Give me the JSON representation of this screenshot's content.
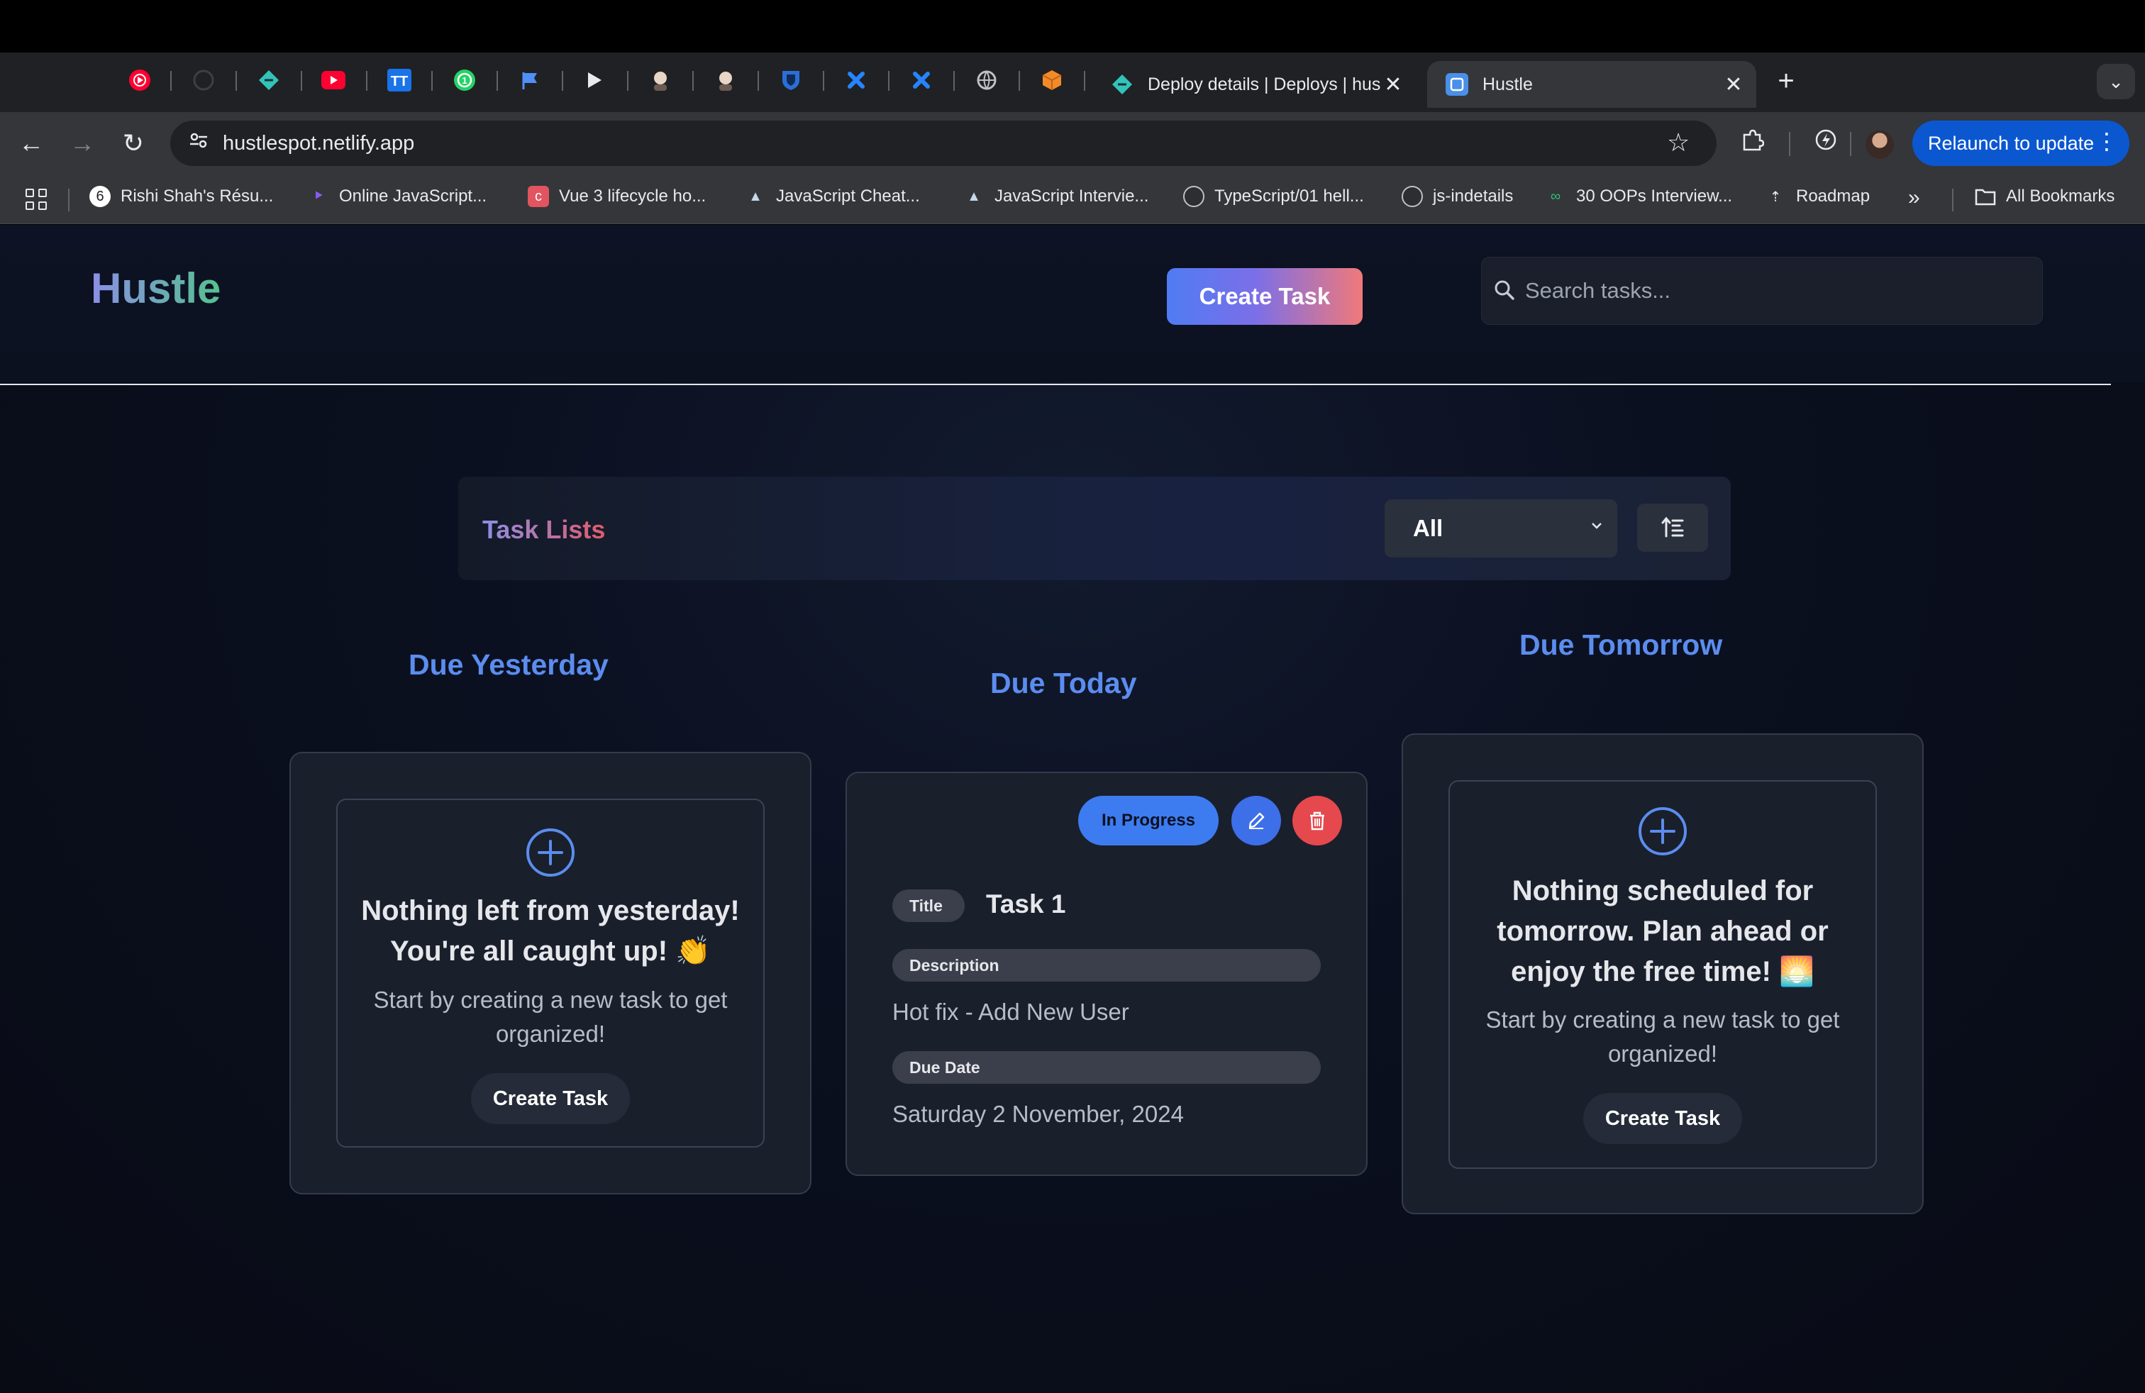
{
  "browser": {
    "tabs": [
      {
        "label": "Deploy details | Deploys | hus",
        "close": "✕"
      },
      {
        "label": "Hustle",
        "close": "✕"
      }
    ],
    "new_tab": "+",
    "tab_search": "⌄",
    "url": "hustlespot.netlify.app",
    "relaunch_label": "Relaunch to update",
    "relaunch_menu": "⋮",
    "bookmarks": [
      "Rishi Shah's Résu...",
      "Online JavaScript...",
      "Vue 3 lifecycle ho...",
      "JavaScript Cheat...",
      "JavaScript Intervie...",
      "TypeScript/01 hell...",
      "js-indetails",
      "30 OOPs Interview...",
      "Roadmap"
    ],
    "bookmarks_overflow": "»",
    "all_bookmarks": "All Bookmarks"
  },
  "header": {
    "logo": "Hustle",
    "create_task": "Create Task",
    "search_placeholder": "Search tasks..."
  },
  "filter": {
    "title": "Task Lists",
    "selected": "All"
  },
  "columns": {
    "yesterday": {
      "title": "Due Yesterday",
      "empty_title_line1": "Nothing left from yesterday!",
      "empty_title_line2": "You're all caught up! 👏",
      "empty_sub_line1": "Start by creating a new task to get",
      "empty_sub_line2": "organized!",
      "button": "Create Task"
    },
    "today": {
      "title": "Due Today",
      "task": {
        "status": "In Progress",
        "title_label": "Title",
        "title": "Task 1",
        "description_label": "Description",
        "description": "Hot fix - Add New User",
        "due_label": "Due Date",
        "due": "Saturday 2 November, 2024"
      }
    },
    "tomorrow": {
      "title": "Due Tomorrow",
      "empty_title_line1": "Nothing scheduled for",
      "empty_title_line2": "tomorrow. Plan ahead or",
      "empty_title_line3": "enjoy the free time! 🌅",
      "empty_sub_line1": "Start by creating a new task to get",
      "empty_sub_line2": "organized!",
      "button": "Create Task"
    }
  },
  "colors": {
    "accent_blue": "#5b8def",
    "status_blue": "#3d7bf0",
    "delete_red": "#e5484d",
    "card_bg": "#1a1f2c"
  }
}
